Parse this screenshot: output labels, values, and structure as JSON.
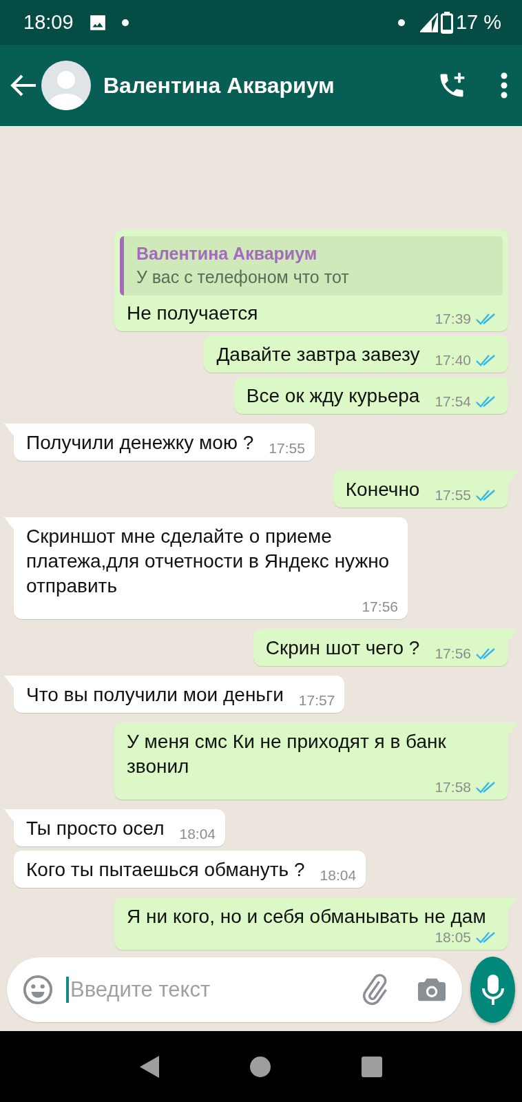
{
  "status_bar": {
    "time": "18:09",
    "battery": "17 %"
  },
  "header": {
    "contact_name": "Валентина Аквариум"
  },
  "messages": [
    {
      "kind": "outgoing",
      "tail": false,
      "quote": {
        "author": "Валентина Аквариум",
        "text": "У вас с телефоном что тот"
      },
      "text": "Не получается",
      "time": "17:39",
      "read": true
    },
    {
      "kind": "outgoing",
      "tail": false,
      "text": "Давайте завтра завезу",
      "time": "17:40",
      "read": true
    },
    {
      "kind": "outgoing",
      "tail": false,
      "text": "Все ок жду курьера",
      "time": "17:54",
      "read": true
    },
    {
      "kind": "incoming",
      "tail": true,
      "text": "Получили денежку мою ?",
      "time": "17:55"
    },
    {
      "kind": "outgoing",
      "tail": true,
      "text": "Конечно",
      "time": "17:55",
      "read": true
    },
    {
      "kind": "incoming",
      "tail": true,
      "text": "Скриншот мне сделайте о приеме платежа,для отчетности в Яндекс нужно отправить",
      "time": "17:56"
    },
    {
      "kind": "outgoing",
      "tail": true,
      "text": "Скрин шот чего ?",
      "time": "17:56",
      "read": true
    },
    {
      "kind": "incoming",
      "tail": true,
      "text": "Что вы получили мои деньги",
      "time": "17:57"
    },
    {
      "kind": "outgoing",
      "tail": true,
      "text": "У меня смс Ки не приходят я в банк звонил",
      "time": "17:58",
      "read": true
    },
    {
      "kind": "incoming",
      "tail": true,
      "text": "Ты просто осел",
      "time": "18:04"
    },
    {
      "kind": "incoming",
      "tail": false,
      "text": "Кого ты пытаешься обмануть ?",
      "time": "18:04"
    },
    {
      "kind": "outgoing",
      "tail": true,
      "text": "Я ни кого, но и себя обманывать не дам",
      "time": "18:05",
      "read": true
    }
  ],
  "composer": {
    "placeholder": "Введите текст"
  }
}
